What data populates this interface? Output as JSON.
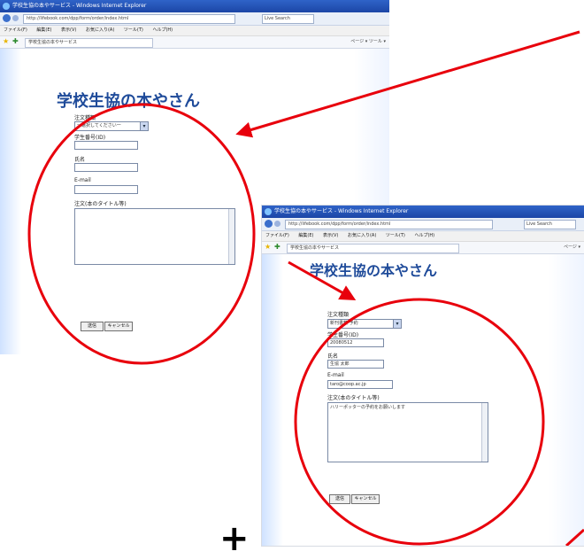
{
  "window1": {
    "title": "学校生協の本やサービス - Windows Internet Explorer",
    "url": "http://lifebook.com/dpp/form/order/index.html",
    "search": "Live Search",
    "menu": [
      "ファイル(F)",
      "編集(E)",
      "表示(V)",
      "お気に入り(A)",
      "ツール(T)",
      "ヘルプ(H)"
    ],
    "tab": "学校生協の本やサービス",
    "tools": "ページ ▾  ツール ▾",
    "heading": "学校生協の本やさん",
    "form": {
      "select_label": "注文種類",
      "select_value": "一選択してください一",
      "student_id_label": "学生番号(ID)",
      "student_id_value": "",
      "name_label": "氏名",
      "name_value": "",
      "email_label": "E-mail",
      "email_value": "",
      "comment_label": "注文(本のタイトル等)",
      "comment_value": "",
      "submit_label": "送信",
      "cancel_label": "キャンセル"
    }
  },
  "window2": {
    "title": "学校生協の本やサービス - Windows Internet Explorer",
    "url": "http://lifebook.com/dpp/form/order/index.html",
    "search": "Live Search",
    "menu": [
      "ファイル(F)",
      "編集(E)",
      "表示(V)",
      "お気に入り(A)",
      "ツール(T)",
      "ヘルプ(H)"
    ],
    "tab": "学校生協の本やサービス",
    "tools": "ページ ▾",
    "heading": "学校生協の本やさん",
    "form": {
      "select_label": "注文種類",
      "select_value": "新刊書籍 予約",
      "student_id_label": "学生番号(ID)",
      "student_id_value": "20080512",
      "name_label": "氏名",
      "name_value": "生協 太郎",
      "email_label": "E-mail",
      "email_value": "taro@coop.ac.jp",
      "comment_label": "注文(本のタイトル等)",
      "comment_value": "ハリーポッターの予約をお願いします",
      "submit_label": "送信",
      "cancel_label": "キャンセル"
    }
  },
  "overlay": {
    "circle_color": "#e8000c",
    "arrow_color": "#e8000c",
    "plus_symbol": "+"
  }
}
